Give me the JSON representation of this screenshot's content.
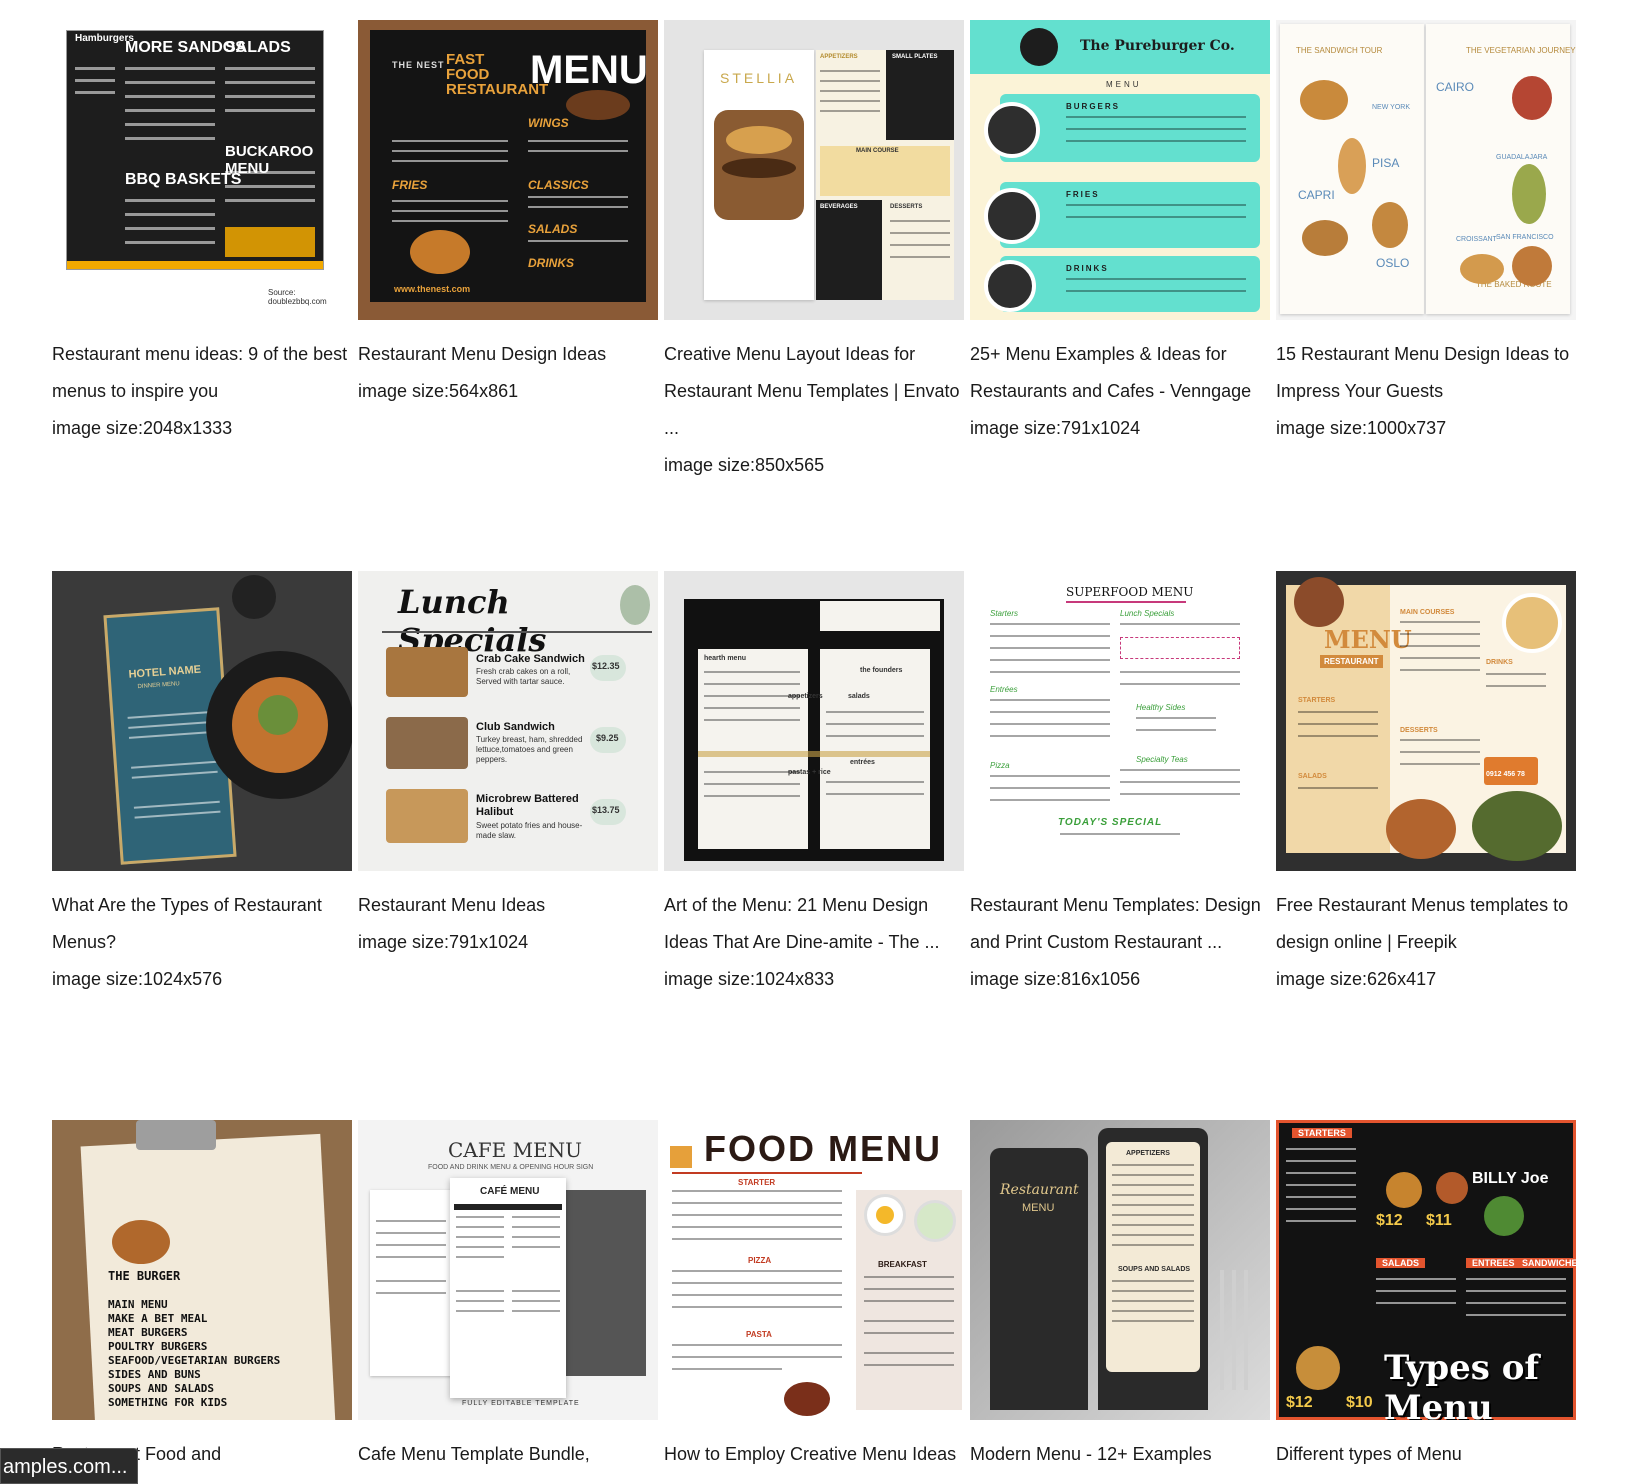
{
  "results": [
    {
      "title": "Restaurant menu ideas: 9 of the best menus to inspire you",
      "size": "image size:2048x1333",
      "thumb": {
        "heading": "MORE SANDOS",
        "heading2": "SALADS",
        "heading3": "BBQ BASKETS",
        "heading4": "BUCKAROO MENU",
        "label": "Hamburgers",
        "source": "Source: doublezbbq.com"
      }
    },
    {
      "title": "Restaurant Menu Design Ideas",
      "size": "image size:564x861",
      "thumb": {
        "heading": "FAST FOOD RESTAURANT",
        "heading2": "MENU",
        "brand": "THE NEST",
        "url": "www.thenest.com",
        "s1": "FRIES",
        "s2": "CLASSICS",
        "s3": "WINGS",
        "s4": "SALADS",
        "s5": "DRINKS"
      }
    },
    {
      "title": "Creative Menu Layout Ideas for Restaurant Menu Templates | Envato ...",
      "size": "image size:850x565",
      "thumb": {
        "heading": "STELLIA",
        "s1": "APPETIZERS",
        "s2": "SMALL PLATES",
        "s3": "MAIN COURSE",
        "s4": "BEVERAGES",
        "s5": "DESSERTS"
      }
    },
    {
      "title": "25+ Menu Examples & Ideas for Restaurants and Cafes - Venngage",
      "size": "image size:791x1024",
      "thumb": {
        "heading": "The Pureburger Co.",
        "label": "MENU",
        "s1": "BURGERS",
        "s2": "FRIES",
        "s3": "DRINKS"
      }
    },
    {
      "title": "15 Restaurant Menu Design Ideas to Impress Your Guests",
      "size": "image size:1000x737",
      "thumb": {
        "heading": "THE SANDWICH TOUR",
        "heading2": "THE VEGETARIAN JOURNEY",
        "c1": "NEW YORK",
        "c2": "PISA",
        "c3": "CAPRI",
        "c4": "OSLO",
        "c5": "CAIRO",
        "c6": "GUADALAJARA",
        "c7": "SAN FRANCISCO",
        "c8": "CROISSANT",
        "c9": "THE BAKED ROUTE"
      }
    },
    {
      "title": "What Are the Types of Restaurant Menus?",
      "size": "image size:1024x576",
      "thumb": {
        "heading": "HOTEL NAME",
        "label": "DINNER MENU"
      }
    },
    {
      "title": "Restaurant Menu Ideas",
      "size": "image size:791x1024",
      "thumb": {
        "heading": "Lunch Specials",
        "items": [
          {
            "name": "Crab Cake Sandwich",
            "desc": "Fresh crab cakes on a roll, Served with tartar sauce.",
            "price": "$12.35"
          },
          {
            "name": "Club Sandwich",
            "desc": "Turkey breast, ham, shredded lettuce,tomatoes and green peppers.",
            "price": "$9.25"
          },
          {
            "name": "Microbrew Battered Halibut",
            "desc": "Sweet potato fries and house-made slaw.",
            "price": "$13.75"
          }
        ]
      }
    },
    {
      "title": "Art of the Menu: 21 Menu Design Ideas That Are Dine-amite - The ...",
      "size": "image size:1024x833",
      "thumb": {
        "s1": "hearth menu",
        "s2": "the founders",
        "s3": "appetizers",
        "s4": "salads",
        "s5": "pastas + rice",
        "s6": "entrées"
      }
    },
    {
      "title": "Restaurant Menu Templates: Design and Print Custom Restaurant ...",
      "size": "image size:816x1056",
      "thumb": {
        "heading": "SUPERFOOD MENU",
        "s1": "Starters",
        "s2": "Lunch Specials",
        "s3": "Entrées",
        "s4": "Healthy Sides",
        "s5": "Pizza",
        "s6": "Specialty Teas",
        "s7": "TODAY'S SPECIAL"
      }
    },
    {
      "title": "Free Restaurant Menus templates to design online | Freepik",
      "size": "image size:626x417",
      "thumb": {
        "heading": "MENU",
        "label": "RESTAURANT",
        "s1": "STARTERS",
        "s2": "MAIN COURSES",
        "s3": "DRINKS",
        "s4": "DESSERTS",
        "s5": "SALADS",
        "phone": "0912 456 78"
      }
    },
    {
      "title": "Restaurant Food and",
      "size": "",
      "thumb": {
        "heading": "THE BURGER",
        "lines": [
          "MAIN MENU",
          "MAKE A BET MEAL",
          "MEAT BURGERS",
          "POULTRY BURGERS",
          "SEAFOOD/VEGETARIAN BURGERS",
          "SIDES AND BUNS",
          "SOUPS AND SALADS",
          "SOMETHING FOR KIDS"
        ]
      }
    },
    {
      "title": "Cafe Menu Template Bundle,",
      "size": "",
      "thumb": {
        "heading": "CAFE MENU",
        "sub": "FOOD AND DRINK MENU & OPENING HOUR SIGN",
        "inner": "CAFÉ MENU",
        "footer": "FULLY EDITABLE TEMPLATE"
      }
    },
    {
      "title": "How to Employ Creative Menu Ideas",
      "size": "",
      "thumb": {
        "heading": "FOOD MENU",
        "s1": "STARTER",
        "s2": "PIZZA",
        "s3": "PASTA",
        "s4": "BREAKFAST"
      }
    },
    {
      "title": "Modern Menu - 12+ Examples",
      "size": "",
      "thumb": {
        "heading": "Restaurant",
        "label": "MENU",
        "s1": "APPETIZERS",
        "s2": "SOUPS AND SALADS"
      }
    },
    {
      "title": "Different types of Menu",
      "size": "",
      "thumb": {
        "heading": "Types of Menu",
        "s1": "STARTERS",
        "s2": "SALADS",
        "s3": "ENTREES",
        "s4": "SANDWICHES",
        "brand": "BILLY Joe",
        "p1": "$12",
        "p2": "$11",
        "p3": "$10"
      }
    }
  ],
  "tooltip": "amples.com..."
}
